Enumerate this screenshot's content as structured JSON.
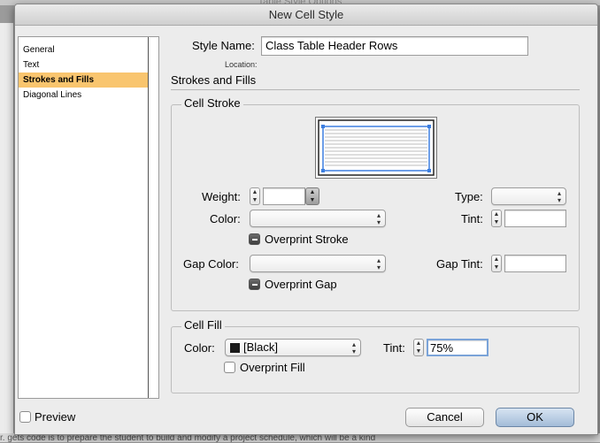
{
  "background": {
    "window_title": "Table Style Options",
    "bottom_text": "r. gets code is to prepare the student to build and modify a project schedule, which will be a kind"
  },
  "dialog": {
    "title": "New Cell Style"
  },
  "sidebar": {
    "items": [
      {
        "label": "General",
        "selected": false
      },
      {
        "label": "Text",
        "selected": false
      },
      {
        "label": "Strokes and Fills",
        "selected": true
      },
      {
        "label": "Diagonal Lines",
        "selected": false
      }
    ]
  },
  "style_name": {
    "label": "Style Name:",
    "value": "Class Table Header Rows",
    "location_label": "Location:"
  },
  "section_heading": "Strokes and Fills",
  "cell_stroke": {
    "title": "Cell Stroke",
    "weight_label": "Weight:",
    "weight_value": "",
    "type_label": "Type:",
    "type_value": "",
    "color_label": "Color:",
    "color_value": "",
    "tint_label": "Tint:",
    "tint_value": "",
    "overprint_stroke_label": "Overprint Stroke",
    "gap_color_label": "Gap Color:",
    "gap_color_value": "",
    "gap_tint_label": "Gap Tint:",
    "gap_tint_value": "",
    "overprint_gap_label": "Overprint Gap"
  },
  "cell_fill": {
    "title": "Cell Fill",
    "color_label": "Color:",
    "color_value": "[Black]",
    "swatch_color": "#1a1a1a",
    "tint_label": "Tint:",
    "tint_value": "75%",
    "overprint_fill_label": "Overprint Fill"
  },
  "footer": {
    "preview_label": "Preview",
    "cancel_label": "Cancel",
    "ok_label": "OK"
  },
  "colors": {
    "selection": "#f9c56e",
    "default_button": "#a3bcd8",
    "proxy_handle": "#3d7fe0"
  }
}
